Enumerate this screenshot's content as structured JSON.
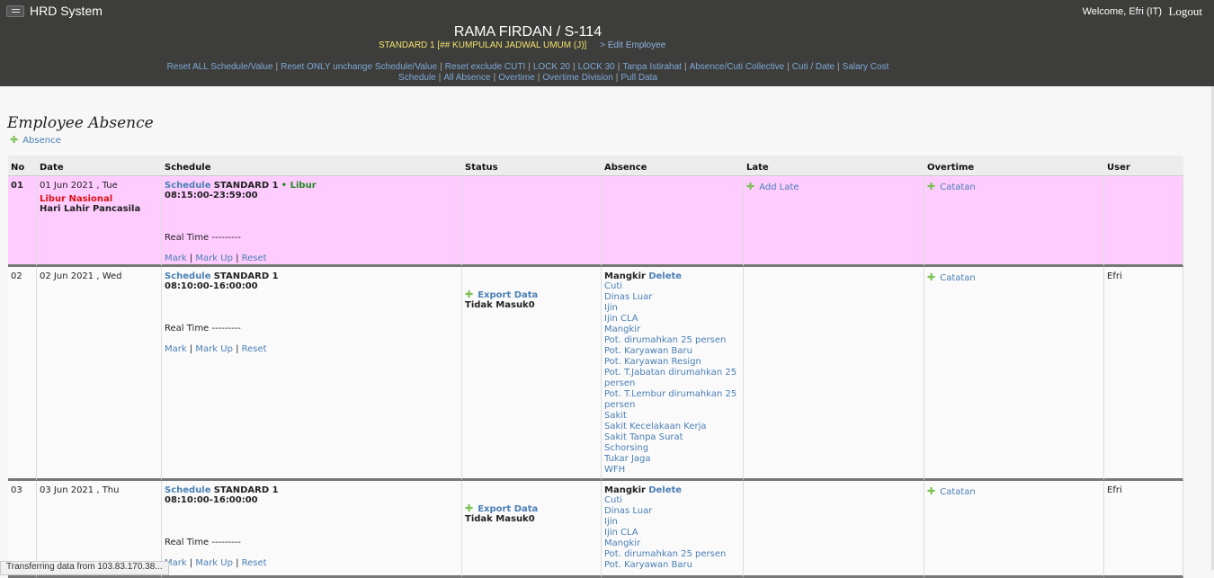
{
  "header": {
    "app_title": "HRD System",
    "welcome": "Welcome, Efri (IT)",
    "logout": "Logout",
    "employee_name": "RAMA FIRDAN / S-114",
    "schedule_info": "STANDARD 1 [## KUMPULAN JADWAL UMUM (J)]",
    "edit_employee": "> Edit Employee",
    "nav_row1": [
      "Reset ALL Schedule/Value",
      "Reset ONLY unchange Schedule/Value",
      "Reset exclude CUTI",
      "LOCK 20",
      "LOCK 30",
      "Tanpa Istirahat",
      "Absence/Cuti Collective",
      "Cuti / Date",
      "Salary Cost"
    ],
    "nav_row2": [
      "Schedule",
      "All Absence",
      "Overtime",
      "Overtime Division",
      "Pull Data"
    ]
  },
  "page": {
    "title": "Employee Absence",
    "add_absence": "Absence"
  },
  "table": {
    "columns": [
      "No",
      "Date",
      "Schedule",
      "Status",
      "Absence",
      "Late",
      "Overtime",
      "User"
    ],
    "rows": [
      {
        "no": "01",
        "date": "01 Jun 2021 , Tue",
        "holiday_label": "Libur Nasional",
        "holiday_name": "Hari Lahir Pancasila",
        "schedule_link": "Schedule",
        "schedule_name": "STANDARD 1",
        "schedule_extra": "• Libur",
        "schedule_time": "08:15:00-23:59:00",
        "real_time": "Real Time ---------",
        "actions": [
          "Mark",
          "Mark Up",
          "Reset"
        ],
        "late_link": "Add Late",
        "overtime_link": "Catatan",
        "user": ""
      },
      {
        "no": "02",
        "date": "02 Jun 2021 , Wed",
        "schedule_link": "Schedule",
        "schedule_name": "STANDARD 1",
        "schedule_time": "08:10:00-16:00:00",
        "real_time": "Real Time ---------",
        "actions": [
          "Mark",
          "Mark Up",
          "Reset"
        ],
        "status_link": "Export Data",
        "status_text": "Tidak Masuk0",
        "absence_current": "Mangkir",
        "absence_delete": "Delete",
        "absence_options": [
          "Cuti",
          "Dinas Luar",
          "Ijin",
          "Ijin CLA",
          "Mangkir",
          "Pot. dirumahkan 25 persen",
          "Pot. Karyawan Baru",
          "Pot. Karyawan Resign",
          "Pot. T.Jabatan dirumahkan 25 persen",
          "Pot. T.Lembur dirumahkan 25 persen",
          "Sakit",
          "Sakit Kecelakaan Kerja",
          "Sakit Tanpa Surat",
          "Schorsing",
          "Tukar Jaga",
          "WFH"
        ],
        "overtime_link": "Catatan",
        "user": "Efri"
      },
      {
        "no": "03",
        "date": "03 Jun 2021 , Thu",
        "schedule_link": "Schedule",
        "schedule_name": "STANDARD 1",
        "schedule_time": "08:10:00-16:00:00",
        "real_time": "Real Time ---------",
        "actions": [
          "Mark",
          "Mark Up",
          "Reset"
        ],
        "status_link": "Export Data",
        "status_text": "Tidak Masuk0",
        "absence_current": "Mangkir",
        "absence_delete": "Delete",
        "absence_options": [
          "Cuti",
          "Dinas Luar",
          "Ijin",
          "Ijin CLA",
          "Mangkir",
          "Pot. dirumahkan 25 persen",
          "Pot. Karyawan Baru"
        ],
        "overtime_link": "Catatan",
        "user": "Efri"
      }
    ]
  },
  "status_bar": "Transferring data from 103.83.170.38..."
}
